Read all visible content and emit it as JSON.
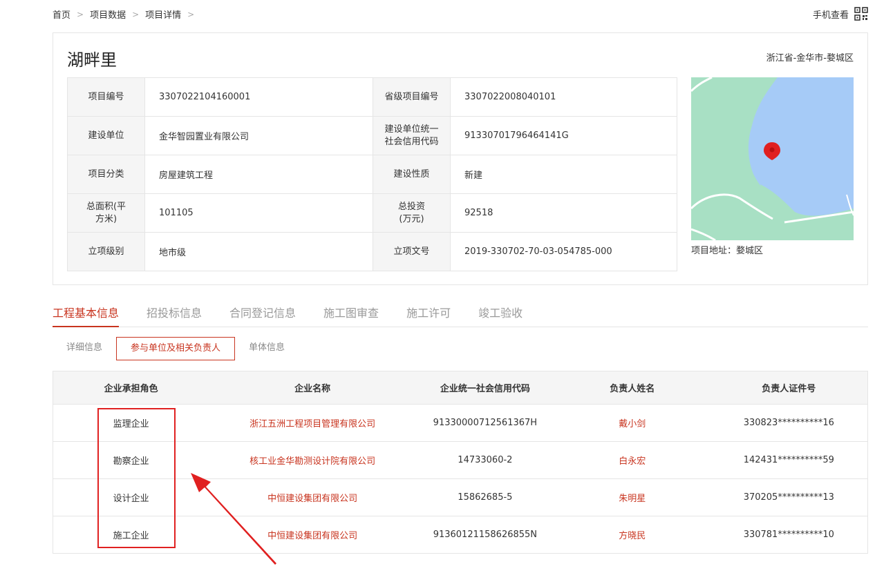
{
  "breadcrumb": [
    "首页",
    "项目数据",
    "项目详情"
  ],
  "mobile_view_label": "手机查看",
  "project": {
    "name": "湖畔里",
    "region": "浙江省-金华市-婺城区",
    "map_address": "项目地址：婺城区",
    "fields": [
      {
        "label": "项目编号",
        "value": "3307022104160001",
        "label2": "省级项目编号",
        "value2": "3307022008040101"
      },
      {
        "label": "建设单位",
        "value": "金华智园置业有限公司",
        "label2": "建设单位统一社会信用代码",
        "value2": "91330701796464141G"
      },
      {
        "label": "项目分类",
        "value": "房屋建筑工程",
        "label2": "建设性质",
        "value2": "新建"
      },
      {
        "label": "总面积(平方米)",
        "value": "101105",
        "label2": "总投资(万元)",
        "value2": "92518"
      },
      {
        "label": "立项级别",
        "value": "地市级",
        "label2": "立项文号",
        "value2": "2019-330702-70-03-054785-000"
      }
    ]
  },
  "tabs": [
    "工程基本信息",
    "招投标信息",
    "合同登记信息",
    "施工图审查",
    "施工许可",
    "竣工验收"
  ],
  "subtabs": [
    "详细信息",
    "参与单位及相关负责人",
    "单体信息"
  ],
  "units_table": {
    "headers": [
      "企业承担角色",
      "企业名称",
      "企业统一社会信用代码",
      "负责人姓名",
      "负责人证件号"
    ],
    "rows": [
      [
        "监理企业",
        "浙江五洲工程项目管理有限公司",
        "9133000071256136​7H",
        "戴小剑",
        "330823**********16"
      ],
      [
        "勘察企业",
        "核工业金华勘测设计院有限公司",
        "14733060-2",
        "白永宏",
        "142431**********59"
      ],
      [
        "设计企业",
        "中恒建设集团有限公司",
        "15862685-5",
        "朱明星",
        "370205**********13"
      ],
      [
        "施工企业",
        "中恒建设集团有限公司",
        "91360121158626855N",
        "方晓民",
        "330781**********10"
      ]
    ]
  },
  "colors": {
    "accent": "#c8341f",
    "annotation": "#e02020"
  }
}
